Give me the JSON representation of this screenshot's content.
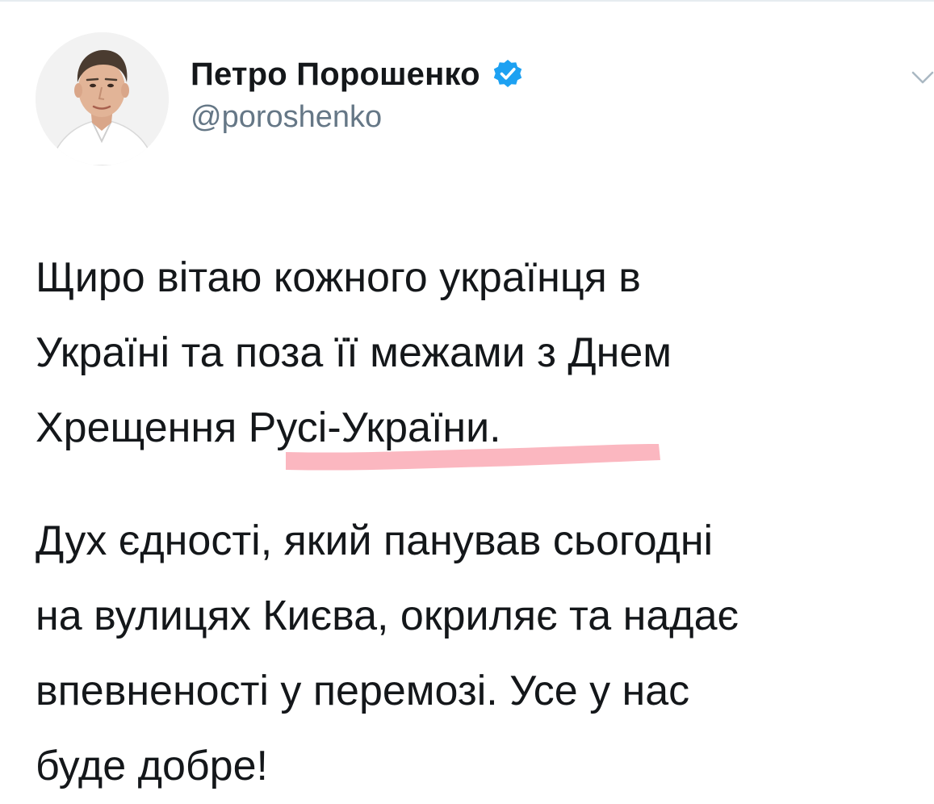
{
  "author": {
    "display_name": "Петро Порошенко",
    "handle": "@poroshenko",
    "avatar_icon": "avatar-photo",
    "verified_icon": "verified-badge-icon"
  },
  "menu": {
    "icon": "chevron-down-icon"
  },
  "tweet": {
    "paragraphs": [
      {
        "lines": [
          "Щиро вітаю кожного українця в",
          "Україні та поза її межами з Днем",
          "Хрещення Русі-України."
        ]
      },
      {
        "lines": [
          "Дух єдності, який панував сьогодні",
          "на вулицях Києва, окриляє та надає",
          "впевненості у перемозі. Усе у нас",
          "буде добре!"
        ]
      }
    ]
  },
  "colors": {
    "text": "#14171a",
    "secondary": "#657786",
    "verified_blue": "#1da1f2",
    "highlight": "#f77b8d"
  }
}
